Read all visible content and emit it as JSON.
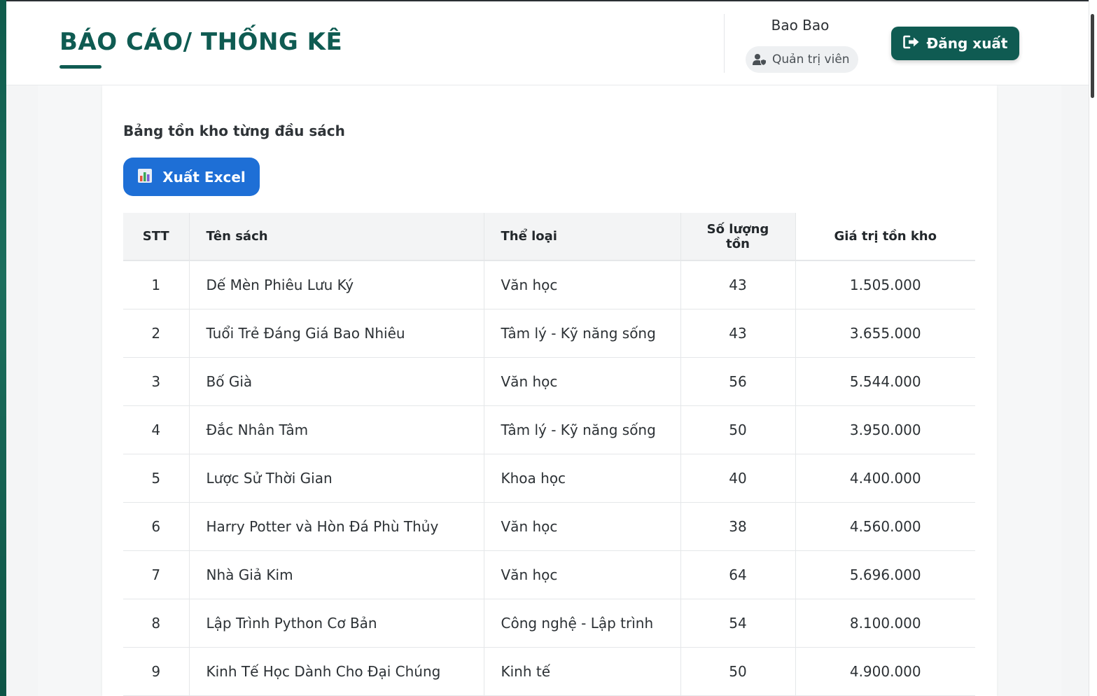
{
  "header": {
    "title": "BÁO CÁO/ THỐNG KÊ",
    "user_name": "Bao Bao",
    "role": "Quản trị viên",
    "logout_label": "Đăng xuất"
  },
  "report": {
    "section_title": "Bảng tồn kho từng đầu sách",
    "export_label": "Xuất Excel",
    "columns": [
      "STT",
      "Tên sách",
      "Thể loại",
      "Số lượng tồn",
      "Giá trị tồn kho"
    ],
    "rows": [
      [
        "1",
        "Dế Mèn Phiêu Lưu Ký",
        "Văn học",
        "43",
        "1.505.000"
      ],
      [
        "2",
        "Tuổi Trẻ Đáng Giá Bao Nhiêu",
        "Tâm lý - Kỹ năng sống",
        "43",
        "3.655.000"
      ],
      [
        "3",
        "Bố Già",
        "Văn học",
        "56",
        "5.544.000"
      ],
      [
        "4",
        "Đắc Nhân Tâm",
        "Tâm lý - Kỹ năng sống",
        "50",
        "3.950.000"
      ],
      [
        "5",
        "Lược Sử Thời Gian",
        "Khoa học",
        "40",
        "4.400.000"
      ],
      [
        "6",
        "Harry Potter và Hòn Đá Phù Thủy",
        "Văn học",
        "38",
        "4.560.000"
      ],
      [
        "7",
        "Nhà Giả Kim",
        "Văn học",
        "64",
        "5.696.000"
      ],
      [
        "8",
        "Lập Trình Python Cơ Bản",
        "Công nghệ - Lập trình",
        "54",
        "8.100.000"
      ],
      [
        "9",
        "Kinh Tế Học Dành Cho Đại Chúng",
        "Kinh tế",
        "50",
        "4.900.000"
      ]
    ]
  },
  "colors": {
    "brand": "#0f5b52",
    "export_button": "#1e6fd6"
  },
  "icons": {
    "role": "user-shield-icon",
    "logout": "sign-out-icon",
    "export": "bar-chart-icon"
  }
}
